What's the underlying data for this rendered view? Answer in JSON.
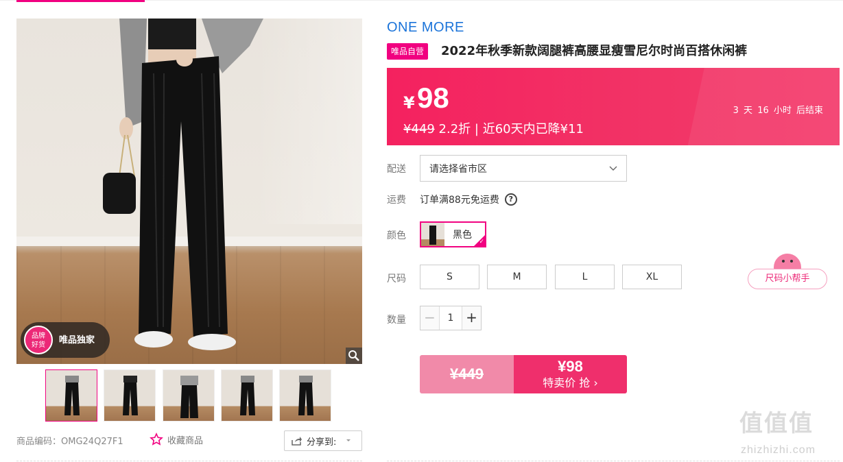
{
  "gallery": {
    "badge_top": "品牌",
    "badge_bottom": "好货",
    "badge_label": "唯品独家",
    "thumbnails": [
      "thumb-1",
      "thumb-2",
      "thumb-3",
      "thumb-4",
      "thumb-5"
    ]
  },
  "meta": {
    "sku_label": "商品编码：",
    "sku_value": "OMG24Q27F1",
    "favorite_label": "收藏商品",
    "share_label": "分享到:"
  },
  "product": {
    "brand": "ONE MORE",
    "self_operated_tag": "唯品自营",
    "title": "2022年秋季新款阔腿裤高腰显瘦雪尼尔时尚百搭休闲裤"
  },
  "price": {
    "currency": "¥",
    "current": "98",
    "original": "¥449",
    "discount": "2.2折",
    "note": "| 近60天内已降¥11",
    "countdown": "3 天 16 小时 后结束"
  },
  "delivery": {
    "label": "配送",
    "placeholder": "请选择省市区"
  },
  "shipping": {
    "label": "运费",
    "text": "订单满88元免运费"
  },
  "color": {
    "label": "颜色",
    "selected": "黑色"
  },
  "size": {
    "label": "尺码",
    "options": [
      "S",
      "M",
      "L",
      "XL"
    ]
  },
  "quantity": {
    "label": "数量",
    "value": "1",
    "minus": "−",
    "plus": "+"
  },
  "buy": {
    "original": "¥449",
    "price": "¥98",
    "text": "特卖价 抢 ›"
  },
  "size_helper": {
    "label": "尺码小帮手"
  },
  "watermark": {
    "glyphs": "值值值",
    "url": "zhizhizhi.com"
  },
  "colors": {
    "accent": "#f10180",
    "banner": "#f4215f",
    "brand_blue": "#1a73d9"
  }
}
